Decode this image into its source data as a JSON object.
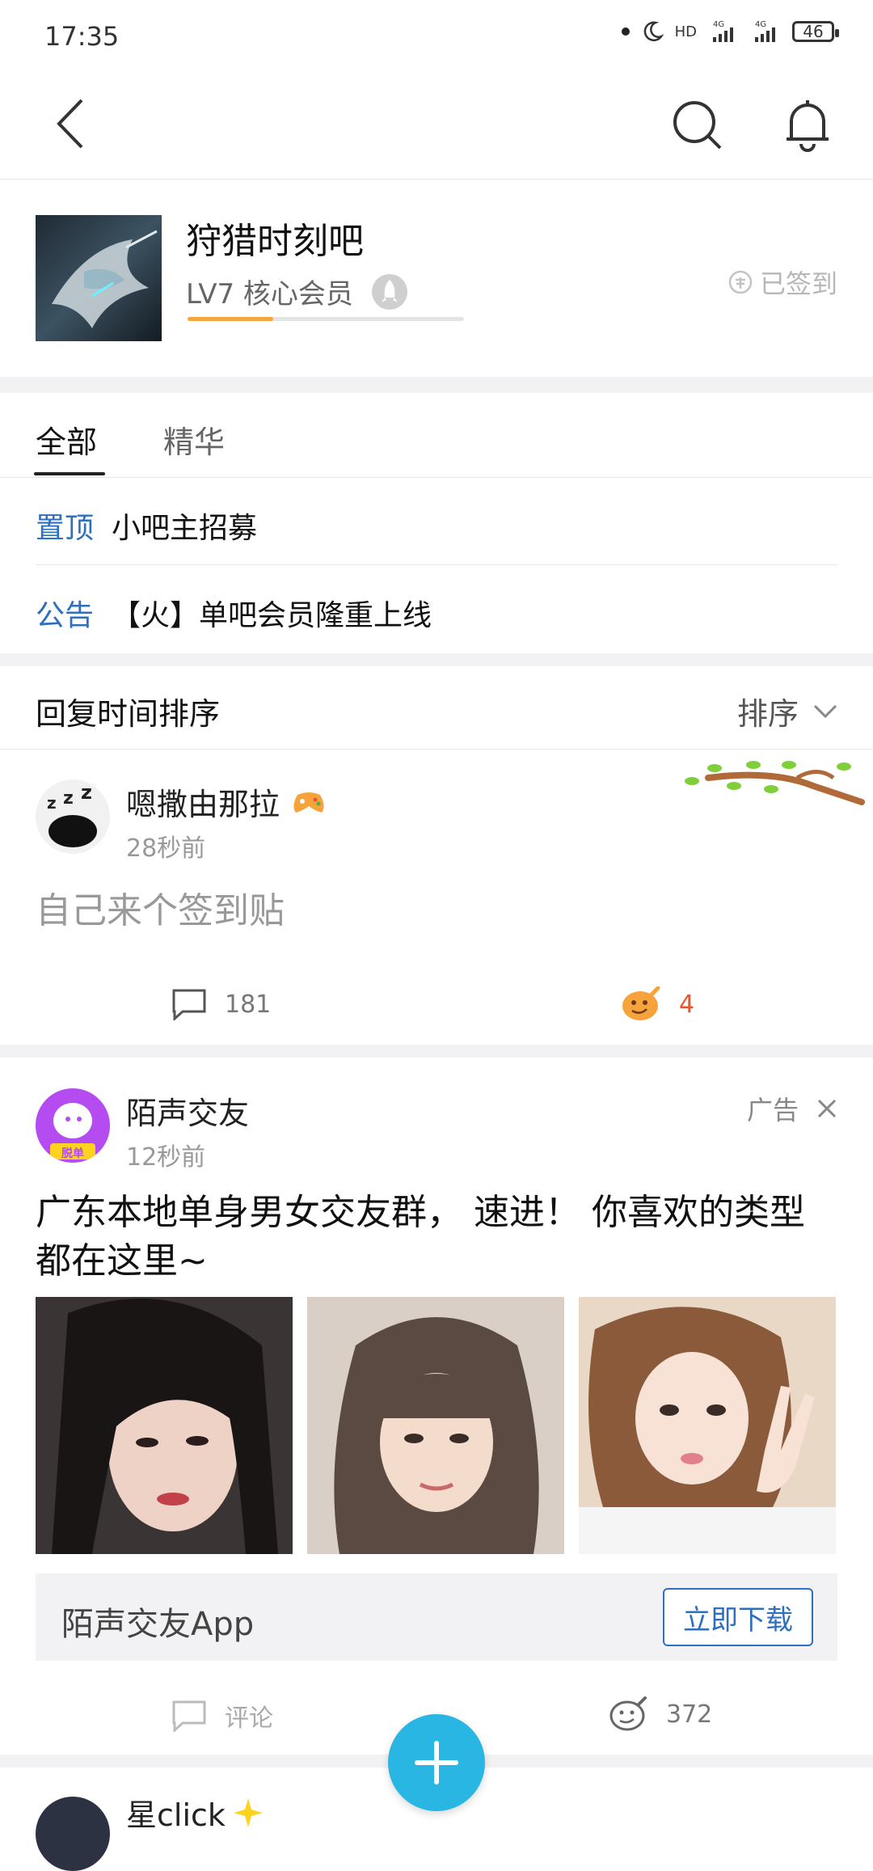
{
  "status_bar": {
    "time": "17:35",
    "network_labels": [
      "HD",
      "4G",
      "4G"
    ],
    "battery": "46"
  },
  "header": {
    "back_icon": "chevron-left-icon",
    "search_icon": "search-icon",
    "bell_icon": "bell-icon"
  },
  "forum": {
    "name": "狩猎时刻吧",
    "level_text": "LV7 核心会员",
    "level_progress": 0.31,
    "checked_in_label": "已签到",
    "checked_in_icon": "checkin-badge-icon"
  },
  "tabs": [
    {
      "label": "全部",
      "active": true
    },
    {
      "label": "精华",
      "active": false
    }
  ],
  "pinned": [
    {
      "tag": "置顶",
      "text": "小吧主招募"
    },
    {
      "tag": "公告",
      "text": "【火】单吧会员隆重上线"
    }
  ],
  "sort": {
    "title": "回复时间排序",
    "button_label": "排序"
  },
  "posts": [
    {
      "username": "嗯撒由那拉",
      "time": "28秒前",
      "title": "自己来个签到贴",
      "comments": "181",
      "reactions": "4"
    }
  ],
  "ad": {
    "name": "陌声交友",
    "time": "12秒前",
    "ad_label": "广告",
    "body": "广东本地单身男女交友群， 速进！ 你喜欢的类型都在这里~",
    "avatar_badge": "脱单",
    "app_name": "陌声交友App",
    "download_label": "立即下载",
    "comment_label": "评论",
    "likes": "372"
  },
  "next_post": {
    "username": "星click"
  },
  "colors": {
    "accent_blue": "#2f6fbf",
    "fab": "#29b6e3",
    "progress": "#f6a63a",
    "reaction_orange": "#e8552b"
  }
}
